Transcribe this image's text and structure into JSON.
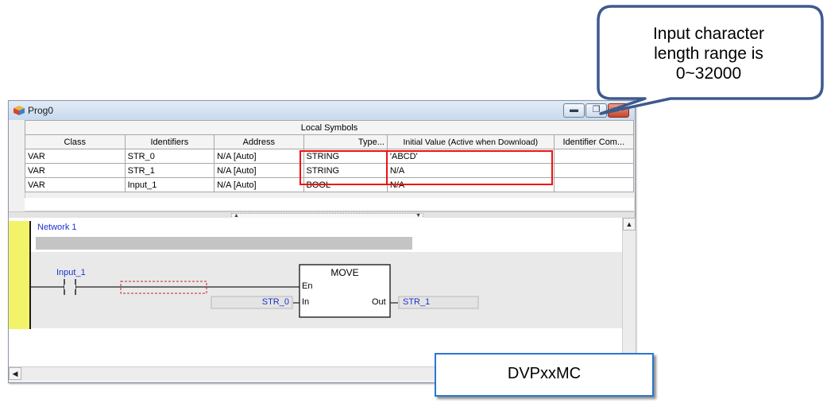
{
  "window": {
    "title": "Prog0"
  },
  "symbols_table": {
    "caption": "Local Symbols",
    "columns": [
      "Class",
      "Identifiers",
      "Address",
      "Type...",
      "Initial Value (Active when Download)",
      "Identifier Com..."
    ],
    "rows": [
      [
        "VAR",
        "STR_0",
        "N/A [Auto]",
        "STRING",
        "'ABCD'",
        ""
      ],
      [
        "VAR",
        "STR_1",
        "N/A [Auto]",
        "STRING",
        "N/A",
        ""
      ],
      [
        "VAR",
        "Input_1",
        "N/A [Auto]",
        "BOOL",
        "N/A",
        ""
      ]
    ]
  },
  "ladder": {
    "network_label": "Network 1",
    "contact_label": "Input_1",
    "block_name": "MOVE",
    "pin_en": "En",
    "pin_in": "In",
    "pin_out": "Out",
    "in_variable": "STR_0",
    "out_variable": "STR_1"
  },
  "callout": {
    "text_line1": "Input character",
    "text_line2": "length range is",
    "text_line3": "0~32000"
  },
  "device_label": "DVPxxMC",
  "colors": {
    "highlight_red": "#ee1111",
    "network_blue": "#1a33cc",
    "rail_yellow": "#f3f36a",
    "callout_border": "#3d5a8e",
    "label_border": "#2a76d2"
  },
  "icons": [
    "app-cube-icon",
    "minimize-icon",
    "restore-icon",
    "close-icon",
    "scroll-up-icon",
    "scroll-left-icon",
    "splitter-grip-icon"
  ]
}
